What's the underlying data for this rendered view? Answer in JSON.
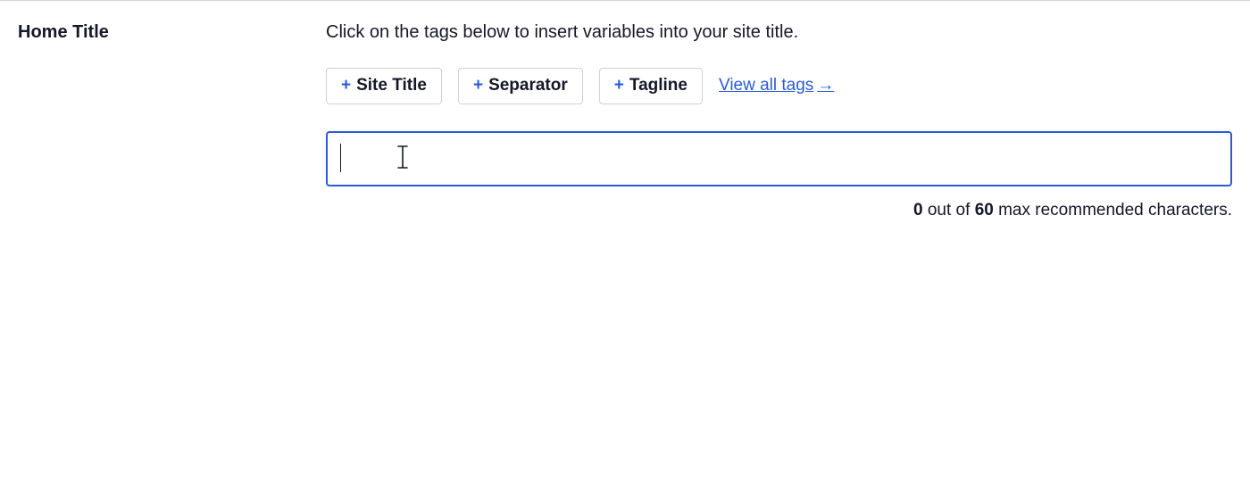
{
  "section": {
    "label": "Home Title",
    "helper": "Click on the tags below to insert variables into your site title."
  },
  "tags": {
    "items": [
      {
        "label": "Site Title"
      },
      {
        "label": "Separator"
      },
      {
        "label": "Tagline"
      }
    ],
    "view_all": "View all tags",
    "arrow": "→"
  },
  "input": {
    "value": "",
    "placeholder": ""
  },
  "counter": {
    "count": "0",
    "mid1": " out of ",
    "max": "60",
    "mid2": " max recommended characters."
  },
  "icons": {
    "plus": "+"
  }
}
